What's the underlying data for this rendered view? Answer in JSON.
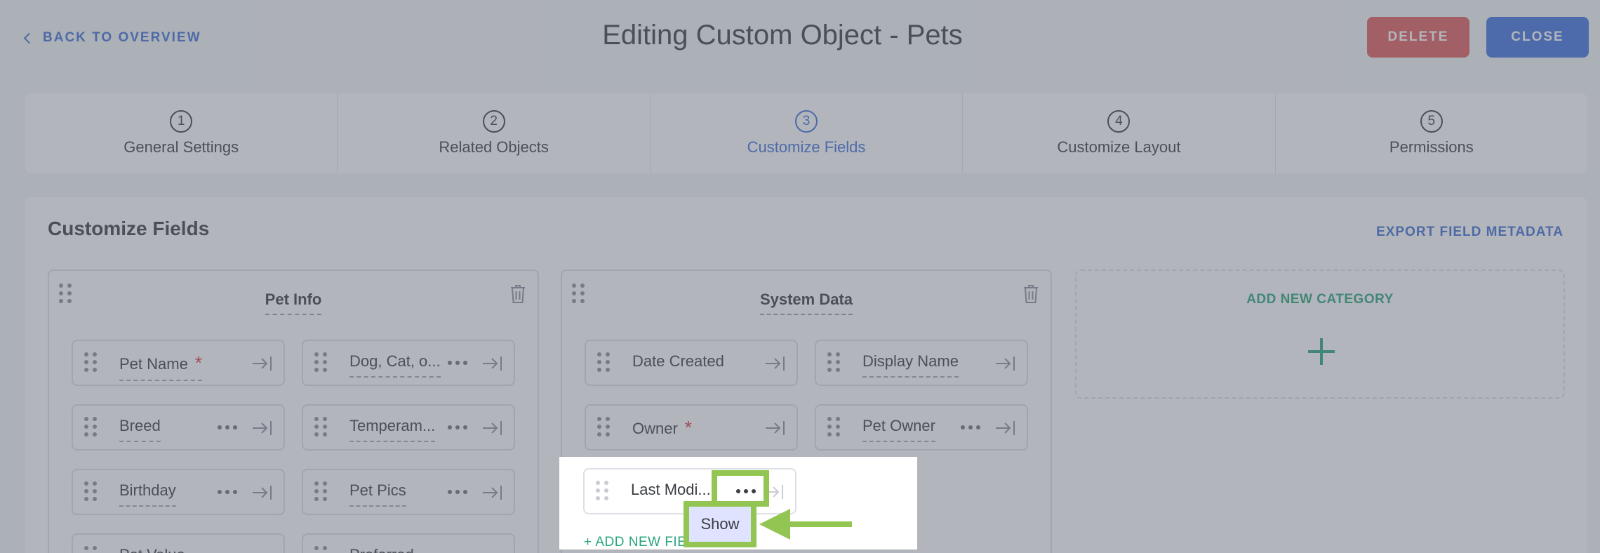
{
  "header": {
    "back_label": "BACK TO OVERVIEW",
    "title": "Editing Custom Object - Pets",
    "delete_label": "DELETE",
    "close_label": "CLOSE"
  },
  "steps": [
    {
      "num": "1",
      "label": "General Settings",
      "active": false
    },
    {
      "num": "2",
      "label": "Related Objects",
      "active": false
    },
    {
      "num": "3",
      "label": "Customize Fields",
      "active": true
    },
    {
      "num": "4",
      "label": "Customize Layout",
      "active": false
    },
    {
      "num": "5",
      "label": "Permissions",
      "active": false
    }
  ],
  "panel": {
    "title": "Customize Fields",
    "export_label": "EXPORT FIELD METADATA",
    "add_category_label": "ADD NEW CATEGORY",
    "add_field_label": "+ ADD NEW FIELD"
  },
  "categories": [
    {
      "title": "Pet Info",
      "fields": [
        {
          "label": "Pet Name",
          "required": true,
          "menu": false
        },
        {
          "label": "Dog, Cat, o...",
          "required": false,
          "menu": true
        },
        {
          "label": "Breed",
          "required": false,
          "menu": true
        },
        {
          "label": "Temperam...",
          "required": false,
          "menu": true
        },
        {
          "label": "Birthday",
          "required": false,
          "menu": true
        },
        {
          "label": "Pet Pics",
          "required": false,
          "menu": true
        },
        {
          "label": "Pet Value",
          "required": false,
          "menu": false
        },
        {
          "label": "Preferred",
          "required": false,
          "menu": false
        }
      ]
    },
    {
      "title": "System Data",
      "fields": [
        {
          "label": "Date Created",
          "required": false,
          "menu": false
        },
        {
          "label": "Display Name",
          "required": false,
          "menu": false
        },
        {
          "label": "Owner",
          "required": true,
          "menu": false
        },
        {
          "label": "Pet Owner",
          "required": false,
          "menu": true
        },
        {
          "label": "Last Modi...",
          "required": false,
          "menu": true
        }
      ]
    }
  ],
  "popup": {
    "show_label": "Show"
  },
  "colors": {
    "accent_blue": "#3e6fe0",
    "delete_red": "#e05a5a",
    "add_green": "#28a57e",
    "highlight_green": "#93c552",
    "required_red": "#d9363e"
  }
}
